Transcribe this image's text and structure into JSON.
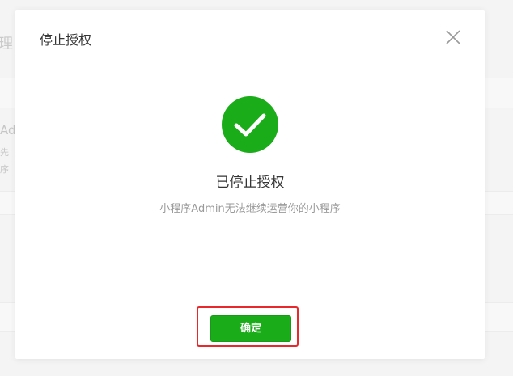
{
  "background": {
    "title_fragment": "理",
    "text_fragments": [
      "Ad",
      "先",
      "序"
    ]
  },
  "dialog": {
    "title": "停止授权",
    "close_icon": "close-icon",
    "result_icon": "success-check-icon",
    "result_title": "已停止授权",
    "result_desc": "小程序Admin无法继续运营你的小程序",
    "confirm_label": "确定"
  },
  "colors": {
    "primary_green": "#1aad19",
    "highlight_red": "#e8282b"
  }
}
